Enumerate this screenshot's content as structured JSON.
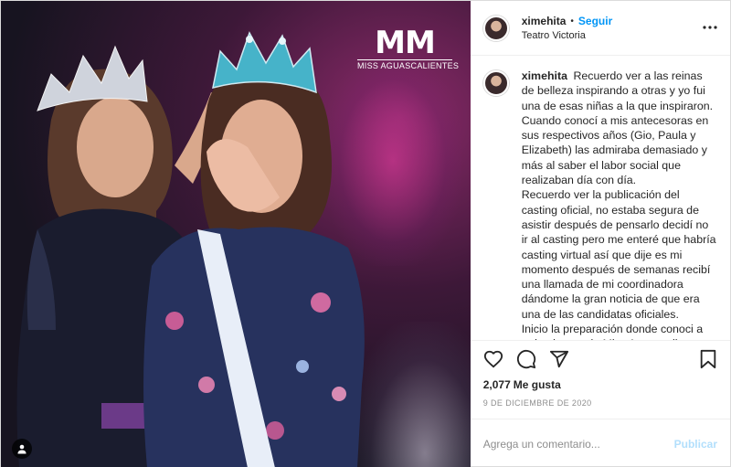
{
  "logo": {
    "mark": "MM",
    "subtitle": "MISS AGUASCALIENTES"
  },
  "header": {
    "username": "ximehita",
    "separator": "•",
    "follow_label": "Seguir",
    "location": "Teatro Victoria",
    "more_icon": "more-horizontal-icon"
  },
  "caption": {
    "username": "ximehita",
    "paragraphs": [
      "Recuerdo ver a las reinas de belleza inspirando a otras y yo fui una de esas niñas a la que inspiraron.",
      "Cuando conocí a mis antecesoras en sus respectivos años (Gio, Paula y Elizabeth) las admiraba demasiado y más al saber el labor social que realizaban día con día.",
      "Recuerdo ver la publicación del casting oficial, no estaba segura de asistir después de pensarlo decidí no ir al casting pero me enteré que habría casting virtual así que dije es mi momento después de semanas recibí una llamada de mi coordinadora dándome la gran noticia de que era una de las candidatas oficiales.",
      "Inicio la preparación donde conoci a todo el team de Miss Aguascalientes y desde ese momento me propuse estar"
    ]
  },
  "actions": {
    "like_icon": "heart-icon",
    "comment_icon": "comment-icon",
    "share_icon": "share-icon",
    "save_icon": "bookmark-icon"
  },
  "likes": {
    "count": "2,077",
    "label": "Me gusta"
  },
  "date": "9 DE DICIEMBRE DE 2020",
  "comment": {
    "placeholder": "Agrega un comentario...",
    "publish_label": "Publicar"
  },
  "colors": {
    "accent": "#0095f6",
    "publish_disabled": "#b2dffc",
    "muted": "#8e8e8e",
    "border": "#efefef"
  }
}
